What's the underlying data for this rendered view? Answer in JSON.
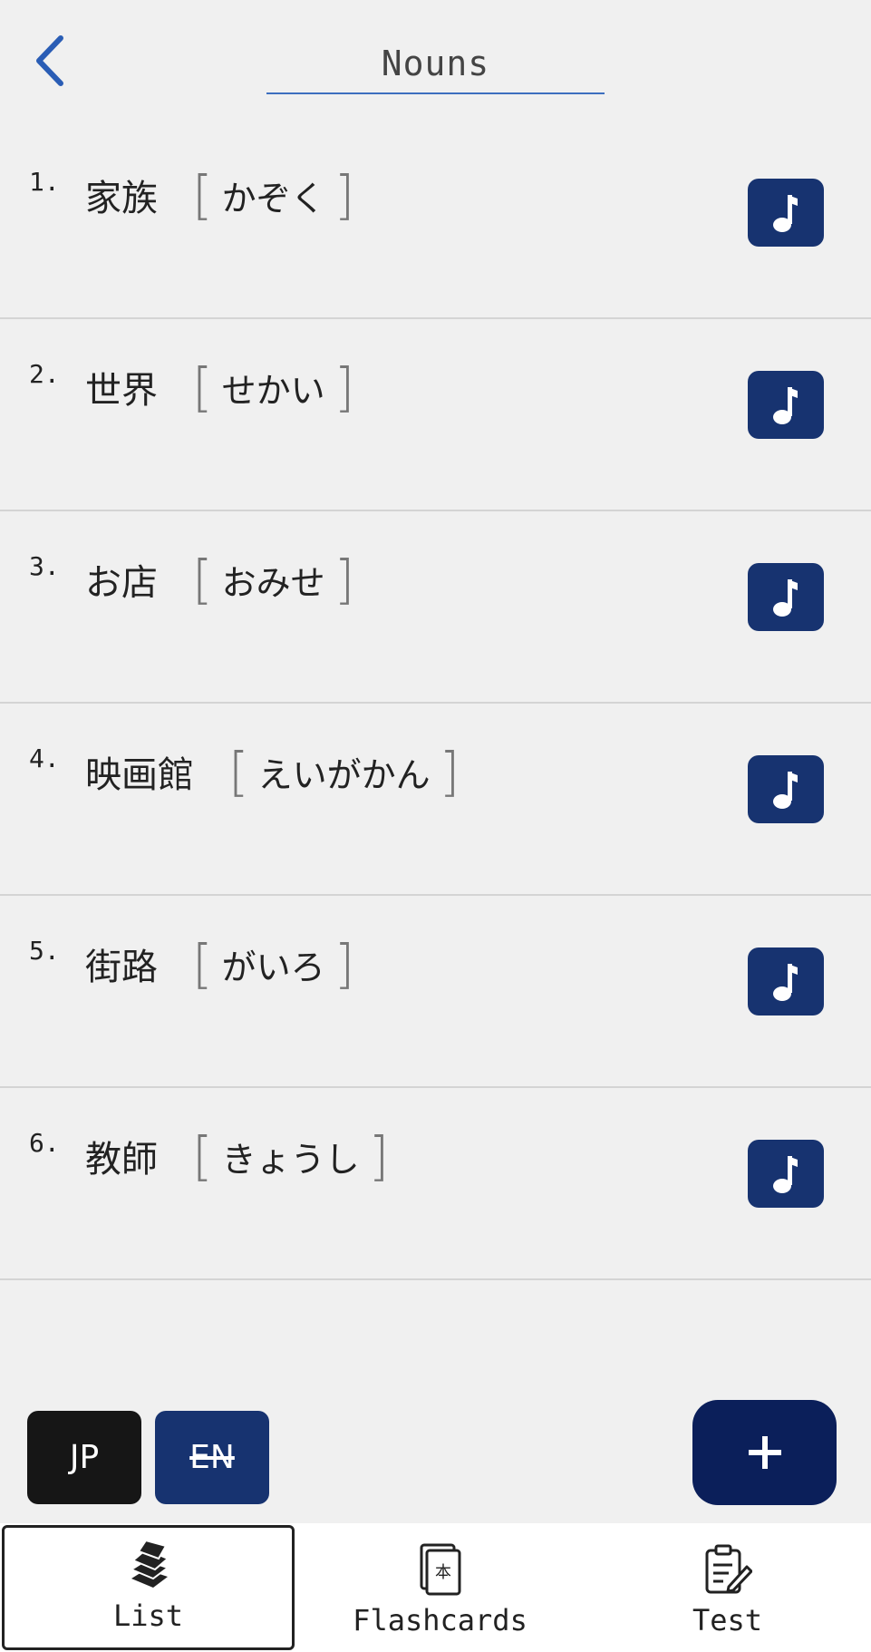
{
  "header": {
    "title": "Nouns"
  },
  "items": [
    {
      "num": "1.",
      "kanji": "家族",
      "kana": "かぞく"
    },
    {
      "num": "2.",
      "kanji": "世界",
      "kana": "せかい"
    },
    {
      "num": "3.",
      "kanji": "お店",
      "kana": "おみせ"
    },
    {
      "num": "4.",
      "kanji": "映画館",
      "kana": "えいがかん"
    },
    {
      "num": "5.",
      "kanji": "街路",
      "kana": "がいろ"
    },
    {
      "num": "6.",
      "kanji": "教師",
      "kana": "きょうし"
    }
  ],
  "brackets": {
    "open": "[",
    "close": "]"
  },
  "toggles": {
    "jp": "JP",
    "en": "EN"
  },
  "tabs": [
    {
      "label": "List",
      "icon": "books-icon",
      "active": true
    },
    {
      "label": "Flashcards",
      "icon": "flashcard-icon",
      "active": false
    },
    {
      "label": "Test",
      "icon": "clipboard-icon",
      "active": false
    }
  ],
  "colors": {
    "accent": "#173370",
    "add": "#0b1f5a",
    "back": "#2a5db5",
    "jp": "#161616"
  }
}
